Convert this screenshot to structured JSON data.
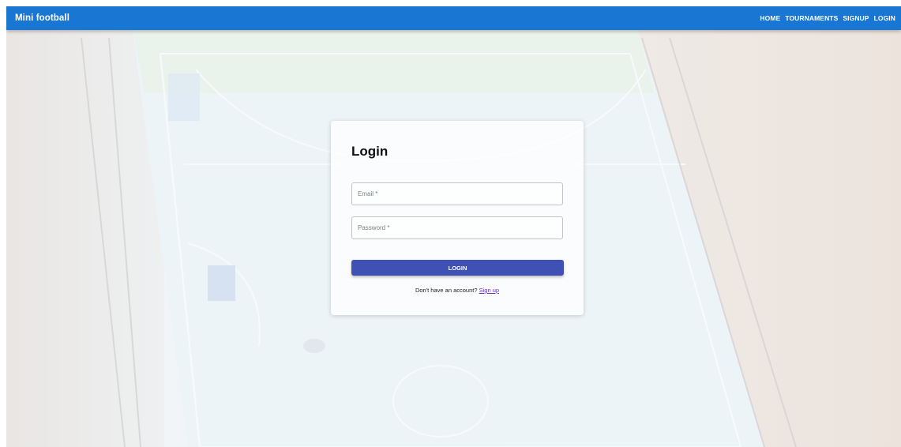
{
  "app": {
    "title": "Mini football"
  },
  "nav": {
    "items": [
      {
        "label": "HOME"
      },
      {
        "label": "TOURNAMENTS"
      },
      {
        "label": "SIGNUP"
      },
      {
        "label": "LOGIN"
      }
    ]
  },
  "login_form": {
    "title": "Login",
    "email_placeholder": "Email *",
    "email_value": "",
    "password_placeholder": "Password *",
    "password_value": "",
    "submit_label": "LOGIN",
    "signup_prompt": "Don't have an account?",
    "signup_link": "Sign up"
  },
  "colors": {
    "appbar": "#1976d2",
    "button": "#3f51b5",
    "link": "#5e35b1"
  }
}
